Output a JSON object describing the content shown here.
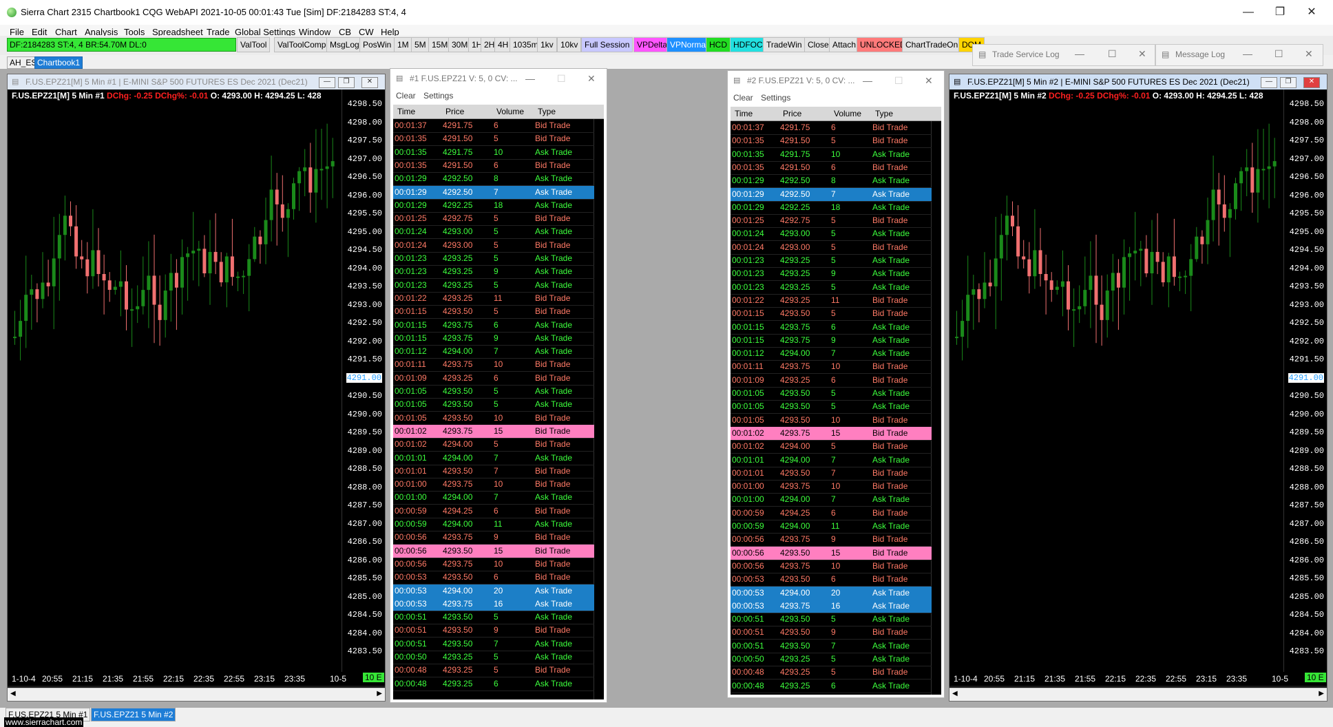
{
  "window": {
    "title": "Sierra Chart 2315 Chartbook1  CQG WebAPI 2021-10-05  00:01:43 Tue [Sim]  DF:2184283  ST:4, 4",
    "minimize": "—",
    "maximize": "❐",
    "close": "✕"
  },
  "menu": [
    "File",
    "Edit",
    "Chart",
    "Analysis",
    "Tools",
    "Spreadsheet",
    "Trade",
    "Global Settings",
    "Window",
    "CB",
    "CW",
    "Help"
  ],
  "status_box": "DF:2184283  ST:4, 4  BR:54.70M  DL:0",
  "toolbar": [
    "ValTool",
    "ValToolComp",
    "MsgLog",
    "PosWin",
    "1M",
    "5M",
    "15M",
    "30M",
    "1H",
    "2H",
    "4H",
    "1035m",
    "1kv",
    "10kv",
    "Full Session",
    "VPDelta",
    "VPNormal",
    "HCD",
    "HDFOC",
    "TradeWin",
    "Close",
    "Attach",
    "UNLOCKED",
    "ChartTradeOn",
    "DOM"
  ],
  "colors": {
    "green": "#36e636",
    "bull": "#1a8a1a",
    "bear": "#f07070",
    "ask": "#3dff3d",
    "bid": "#ff7a66",
    "highlight_blue": "#1c7fc7",
    "highlight_pink": "#ff7fc0",
    "vpdelta": "#ff55ff",
    "vpnormal": "#1e90ff",
    "unlocked": "#ff7a7a",
    "dom": "#ffd400",
    "hcd": "#22dd22",
    "hdfoc": "#22e0e0",
    "fullsession": "#c8c8ff"
  },
  "tabs": [
    "AH_ES",
    "Chartbook1"
  ],
  "chart1": {
    "title": "F.US.EPZ21[M]  5 Min  #1 | E-MINI S&P 500 FUTURES ES Dec 2021 (Dec21)",
    "header_symbol": "F.US.EPZ21[M]  5 Min  #1",
    "dchg": "DChg: -0.25",
    "dchgpct": "DChg%: -0.01",
    "ohlc": "O: 4293.00 H: 4294.25 L: 428",
    "yticks": [
      "4298.50",
      "4298.00",
      "4297.50",
      "4297.00",
      "4296.50",
      "4296.00",
      "4295.50",
      "4295.00",
      "4294.50",
      "4294.00",
      "4293.50",
      "4293.00",
      "4292.50",
      "4292.00",
      "4291.50",
      "4291.00",
      "4290.50",
      "4290.00",
      "4289.50",
      "4289.00",
      "4288.50",
      "4288.00",
      "4287.50",
      "4287.00",
      "4286.50",
      "4286.00",
      "4285.50",
      "4285.00",
      "4284.50",
      "4284.00",
      "4283.50"
    ],
    "current_price": "4291.00",
    "xticks": [
      "1-10-4",
      "20:55",
      "21:15",
      "21:35",
      "21:55",
      "22:15",
      "22:35",
      "22:55",
      "23:15",
      "23:35"
    ],
    "xright": "10-5",
    "badge": "10 E"
  },
  "chart2": {
    "title": "F.US.EPZ21[M]  5 Min  #2 | E-MINI S&P 500 FUTURES ES Dec 2021 (Dec21)",
    "header_symbol": "F.US.EPZ21[M]  5 Min  #2",
    "dchg": "DChg: -0.25",
    "dchgpct": "DChg%: -0.01",
    "ohlc": "O: 4293.00 H: 4294.25 L: 428",
    "yticks": [
      "4298.50",
      "4298.00",
      "4297.50",
      "4297.00",
      "4296.50",
      "4296.00",
      "4295.50",
      "4295.00",
      "4294.50",
      "4294.00",
      "4293.50",
      "4293.00",
      "4292.50",
      "4292.00",
      "4291.50",
      "4291.00",
      "4290.50",
      "4290.00",
      "4289.50",
      "4289.00",
      "4288.50",
      "4288.00",
      "4287.50",
      "4287.00",
      "4286.50",
      "4286.00",
      "4285.50",
      "4285.00",
      "4284.50",
      "4284.00",
      "4283.50"
    ],
    "current_price": "4291.00",
    "xticks": [
      "1-10-4",
      "20:55",
      "21:15",
      "21:35",
      "21:55",
      "22:15",
      "22:35",
      "22:55",
      "23:15",
      "23:35"
    ],
    "xright": "10-5",
    "badge": "10 E"
  },
  "ts1": {
    "title": "#1 F.US.EPZ21  V: 5, 0  CV: ...",
    "menu": [
      "Clear",
      "Settings"
    ],
    "headers": [
      "Time",
      "Price",
      "Volume",
      "Type"
    ]
  },
  "ts2": {
    "title": "#2 F.US.EPZ21  V: 5, 0  CV: ...",
    "menu": [
      "Clear",
      "Settings"
    ],
    "headers": [
      "Time",
      "Price",
      "Volume",
      "Type"
    ]
  },
  "trades": [
    [
      "00:01:37",
      "4291.75",
      "6",
      "Bid Trade"
    ],
    [
      "00:01:35",
      "4291.50",
      "5",
      "Bid Trade"
    ],
    [
      "00:01:35",
      "4291.75",
      "10",
      "Ask Trade"
    ],
    [
      "00:01:35",
      "4291.50",
      "6",
      "Bid Trade"
    ],
    [
      "00:01:29",
      "4292.50",
      "8",
      "Ask Trade"
    ],
    [
      "00:01:29",
      "4292.50",
      "7",
      "Ask Trade"
    ],
    [
      "00:01:29",
      "4292.25",
      "18",
      "Ask Trade"
    ],
    [
      "00:01:25",
      "4292.75",
      "5",
      "Bid Trade"
    ],
    [
      "00:01:24",
      "4293.00",
      "5",
      "Ask Trade"
    ],
    [
      "00:01:24",
      "4293.00",
      "5",
      "Bid Trade"
    ],
    [
      "00:01:23",
      "4293.25",
      "5",
      "Ask Trade"
    ],
    [
      "00:01:23",
      "4293.25",
      "9",
      "Ask Trade"
    ],
    [
      "00:01:23",
      "4293.25",
      "5",
      "Ask Trade"
    ],
    [
      "00:01:22",
      "4293.25",
      "11",
      "Bid Trade"
    ],
    [
      "00:01:15",
      "4293.50",
      "5",
      "Bid Trade"
    ],
    [
      "00:01:15",
      "4293.75",
      "6",
      "Ask Trade"
    ],
    [
      "00:01:15",
      "4293.75",
      "9",
      "Ask Trade"
    ],
    [
      "00:01:12",
      "4294.00",
      "7",
      "Ask Trade"
    ],
    [
      "00:01:11",
      "4293.75",
      "10",
      "Bid Trade"
    ],
    [
      "00:01:09",
      "4293.25",
      "6",
      "Bid Trade"
    ],
    [
      "00:01:05",
      "4293.50",
      "5",
      "Ask Trade"
    ],
    [
      "00:01:05",
      "4293.50",
      "5",
      "Ask Trade"
    ],
    [
      "00:01:05",
      "4293.50",
      "10",
      "Bid Trade"
    ],
    [
      "00:01:02",
      "4293.75",
      "15",
      "Bid Trade"
    ],
    [
      "00:01:02",
      "4294.00",
      "5",
      "Bid Trade"
    ],
    [
      "00:01:01",
      "4294.00",
      "7",
      "Ask Trade"
    ],
    [
      "00:01:01",
      "4293.50",
      "7",
      "Bid Trade"
    ],
    [
      "00:01:00",
      "4293.75",
      "10",
      "Bid Trade"
    ],
    [
      "00:01:00",
      "4294.00",
      "7",
      "Ask Trade"
    ],
    [
      "00:00:59",
      "4294.25",
      "6",
      "Bid Trade"
    ],
    [
      "00:00:59",
      "4294.00",
      "11",
      "Ask Trade"
    ],
    [
      "00:00:56",
      "4293.75",
      "9",
      "Bid Trade"
    ],
    [
      "00:00:56",
      "4293.50",
      "15",
      "Bid Trade"
    ],
    [
      "00:00:56",
      "4293.75",
      "10",
      "Bid Trade"
    ],
    [
      "00:00:53",
      "4293.50",
      "6",
      "Bid Trade"
    ],
    [
      "00:00:53",
      "4294.00",
      "20",
      "Ask Trade"
    ],
    [
      "00:00:53",
      "4293.75",
      "16",
      "Ask Trade"
    ],
    [
      "00:00:51",
      "4293.50",
      "5",
      "Ask Trade"
    ],
    [
      "00:00:51",
      "4293.50",
      "9",
      "Bid Trade"
    ],
    [
      "00:00:51",
      "4293.50",
      "7",
      "Ask Trade"
    ],
    [
      "00:00:50",
      "4293.25",
      "5",
      "Ask Trade"
    ],
    [
      "00:00:48",
      "4293.25",
      "5",
      "Bid Trade"
    ],
    [
      "00:00:48",
      "4293.25",
      "6",
      "Ask Trade"
    ]
  ],
  "trade_highlights": {
    "blue": [
      5,
      35,
      36
    ],
    "pink": [
      23,
      32
    ]
  },
  "logs": [
    {
      "title": "Trade Service Log"
    },
    {
      "title": "Message Log"
    }
  ],
  "bottom_tabs": [
    "F.US.EPZ21  5 Min  #1",
    "F.US.EPZ21  5 Min  #2"
  ],
  "footer": "www.sierrachart.com"
}
